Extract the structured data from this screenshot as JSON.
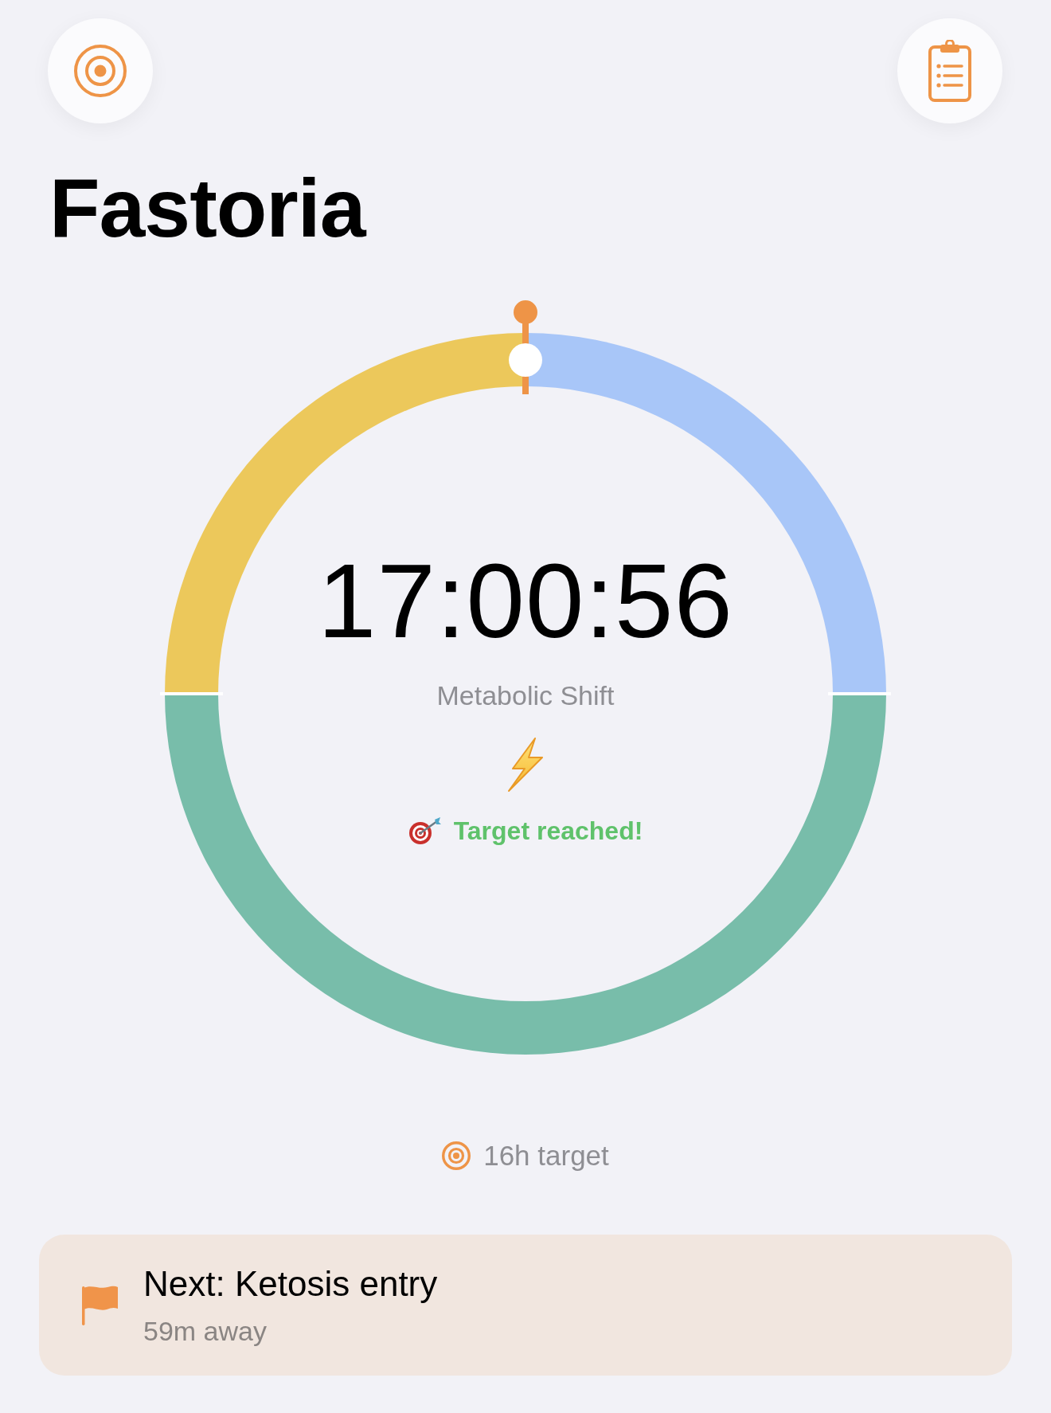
{
  "header": {
    "buttons": [
      {
        "kind": "target"
      },
      {
        "kind": "clipboard"
      }
    ],
    "title": "Fastoria"
  },
  "timer": {
    "segments": [
      {
        "kind": "quarter",
        "color": "#ecc85b"
      },
      {
        "kind": "quarter",
        "color": "#a8c6f8"
      },
      {
        "kind": "half",
        "color": "#78bdaa"
      }
    ],
    "elapsed": "17:00:56",
    "phase": "Metabolic Shift",
    "status": "Target reached!"
  },
  "goal": {
    "label": "16h target"
  },
  "next_card": {
    "title": "Next: Ketosis entry",
    "subtitle": "59m away"
  }
}
